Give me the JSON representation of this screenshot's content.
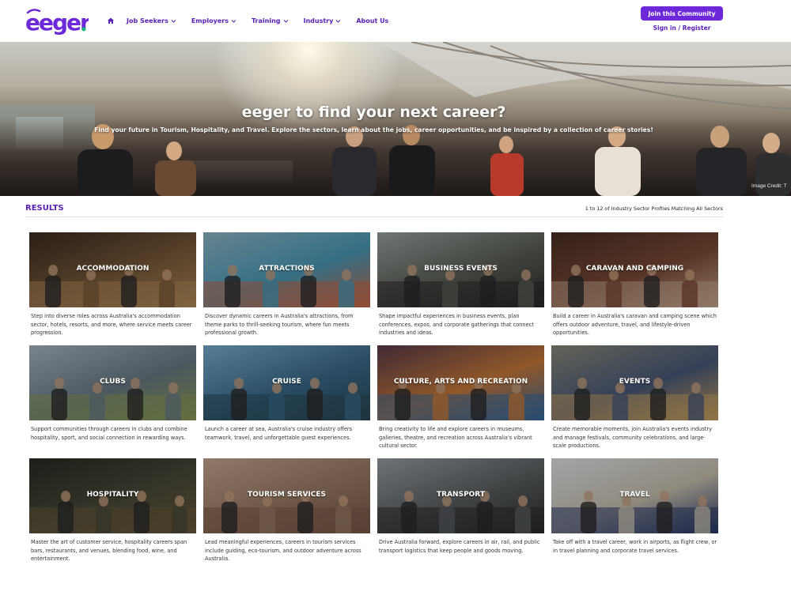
{
  "brand": {
    "logo_text": "eeger",
    "accent": "#6d28d9",
    "accent_dark": "#5b21b6",
    "dot_color": "#10b981"
  },
  "nav": {
    "home_icon": "home-icon",
    "items": [
      {
        "label": "Job Seekers",
        "has_dropdown": true
      },
      {
        "label": "Employers",
        "has_dropdown": true
      },
      {
        "label": "Training",
        "has_dropdown": true
      },
      {
        "label": "Industry",
        "has_dropdown": true
      },
      {
        "label": "About Us",
        "has_dropdown": false
      }
    ]
  },
  "header": {
    "join_label": "Join this Community",
    "signin_label": "Sign in / Register"
  },
  "hero": {
    "title": "eeger to find your next career?",
    "subtitle": "Find your future in Tourism, Hospitality, and Travel. Explore the sectors, learn about the jobs, career opportunities, and be inspired by a collection of career stories!",
    "credit": "Image Credit: T"
  },
  "results": {
    "label": "RESULTS",
    "count_text": "1 to 12 of Industry Sector Profiles Matching All Sectors"
  },
  "cards": [
    {
      "title": "ACCOMMODATION",
      "desc": "Step into diverse roles across Australia's accommodation sector, hotels, resorts, and more, where service meets career progression.",
      "colors": [
        "#3a2a1e",
        "#7a5a3a",
        "#b08a5a"
      ]
    },
    {
      "title": "ATTRACTIONS",
      "desc": "Discover dynamic careers in Australia's attractions, from theme parks to thrill-seeking tourism, where fun meets professional growth.",
      "colors": [
        "#8fb8c8",
        "#4a9ab8",
        "#c86a4a"
      ]
    },
    {
      "title": "BUSINESS EVENTS",
      "desc": "Shape impactful experiences in business events, plan conferences, expos, and corporate gatherings that connect industries and ideas.",
      "colors": [
        "#9aa4a0",
        "#5a5e56",
        "#2a2a28"
      ]
    },
    {
      "title": "CARAVAN AND CAMPING",
      "desc": "Build a career in Australia's caravan and camping scene which offers outdoor adventure, travel, and lifestyle-driven opportunities.",
      "colors": [
        "#4a2e24",
        "#7a4a36",
        "#c8a890"
      ]
    },
    {
      "title": "CLUBS",
      "desc": "Support communities through careers in clubs and combine hospitality, sport, and social connection in rewarding ways.",
      "colors": [
        "#a8b8c4",
        "#6a7a84",
        "#8a9a5a"
      ]
    },
    {
      "title": "CRUISE",
      "desc": "Launch a career at sea, Australia's cruise industry offers teamwork, travel, and unforgettable guest experiences.",
      "colors": [
        "#7ab0d0",
        "#3a6a8a",
        "#2a4a5a"
      ]
    },
    {
      "title": "CULTURE, ARTS AND RECREATION",
      "desc": "Bring creativity to life and explore careers in museums, galleries, theatre, and recreation across Australia's vibrant cultural sector.",
      "colors": [
        "#5a3a4a",
        "#c87a3a",
        "#3a6a9a"
      ]
    },
    {
      "title": "EVENTS",
      "desc": "Create memorable moments, join Australia's events industry and manage festivals, community celebrations, and large-scale productions.",
      "colors": [
        "#8a8a7a",
        "#4a5a7a",
        "#c8a060"
      ]
    },
    {
      "title": "HOSPITALITY",
      "desc": "Master the art of customer service, hospitality careers span bars, restaurants, and venues, blending food, wine, and entertainment.",
      "colors": [
        "#2a2a24",
        "#4a4a3a",
        "#6a5a3a"
      ]
    },
    {
      "title": "TOURISM SERVICES",
      "desc": "Lead meaningful experiences, careers in tourism services include guiding, eco-tourism, and outdoor adventure across Australia.",
      "colors": [
        "#c8a890",
        "#9a7a64",
        "#7a5a48"
      ]
    },
    {
      "title": "TRANSPORT",
      "desc": "Drive Australia forward, explore careers in air, rail, and public transport logistics that keep people and goods moving.",
      "colors": [
        "#9aa0a4",
        "#5a5e60",
        "#2a2c2e"
      ]
    },
    {
      "title": "TRAVEL",
      "desc": "Take off with a travel career, work in airports, as flight crew, or in travel planning and corporate travel services.",
      "colors": [
        "#e0e4e8",
        "#c8c0b0",
        "#2a3a6a"
      ]
    }
  ]
}
